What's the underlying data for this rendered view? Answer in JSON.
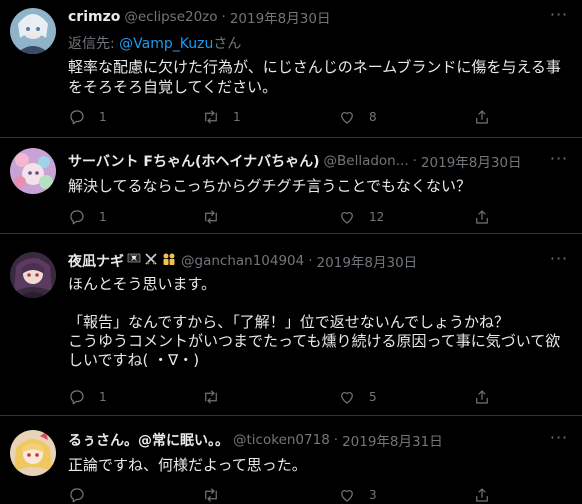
{
  "tweets": [
    {
      "name": "crimzo",
      "handle": "@eclipse20zo",
      "dot": "·",
      "date": "2019年8月30日",
      "reply_prefix": "返信先: ",
      "reply_mention": "@Vamp_Kuzu",
      "reply_suffix": "さん",
      "text": "軽率な配慮に欠けた行為が、にじさんじのネームブランドに傷を与える事\nをそろそろ自覚してください。",
      "replies": "1",
      "retweets": "1",
      "likes": "8"
    },
    {
      "name": "サーバント Fちゃん(ホヘイナバちゃん)",
      "handle": "@Belladon...",
      "dot": "·",
      "date": "2019年8月30日",
      "text": "解決してるならこっちからグチグチ言うことでもなくない？",
      "replies": "1",
      "retweets": "",
      "likes": "12"
    },
    {
      "name": "夜凪ナギ",
      "handle": "@ganchan104904",
      "dot": "·",
      "date": "2019年8月30日",
      "text": "ほんとそう思います。\n\n「報告」なんですから、「了解！」位で返せないんでしょうかね？\nこうゆうコメントがいつまでたっても燻り続ける原因って事に気づいて欲\nしいですね( ・∇・)",
      "replies": "1",
      "retweets": "",
      "likes": "5"
    },
    {
      "name": "るぅさん。@常に眠い。。",
      "handle": "@ticoken0718",
      "dot": "·",
      "date": "2019年8月31日",
      "text": "正論ですね、何様だよって思った。",
      "replies": "",
      "retweets": "",
      "likes": "3"
    }
  ],
  "more_label": "···",
  "colors": {
    "background": "#000000",
    "text": "#e7e9ea",
    "muted": "#71767b",
    "link": "#1d9bf0"
  },
  "icons": [
    "reply-icon",
    "retweet-icon",
    "like-icon",
    "share-icon",
    "more-icon"
  ],
  "name_emojis": [
    "pirate-flag-icon",
    "crossed-swords-icon",
    "people-icon"
  ]
}
